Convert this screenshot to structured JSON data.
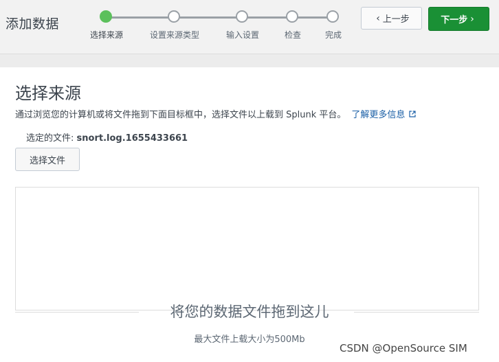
{
  "header": {
    "title": "添加数据",
    "steps": [
      {
        "label": "选择来源",
        "active": true
      },
      {
        "label": "设置来源类型",
        "active": false
      },
      {
        "label": "输入设置",
        "active": false
      },
      {
        "label": "检查",
        "active": false
      },
      {
        "label": "完成",
        "active": false
      }
    ],
    "prev_label": "上一步",
    "next_label": "下一步",
    "prev_icon": "chevron-left-icon",
    "next_icon": "chevron-right-icon",
    "accent_color": "#5cc05c",
    "next_button_color": "#1a9035"
  },
  "main": {
    "title": "选择来源",
    "description": "通过浏览您的计算机或将文件拖到下面目标框中，选择文件以上载到 Splunk 平台。",
    "learn_more": "了解更多信息",
    "selected_file_label": "选定的文件:",
    "selected_file_name": "snort.log.1655433661",
    "select_file_button": "选择文件",
    "drop_title": "将您的数据文件拖到这儿",
    "drop_subtitle": "最大文件上载大小为500Mb"
  },
  "watermark": "CSDN @OpenSource SIM"
}
